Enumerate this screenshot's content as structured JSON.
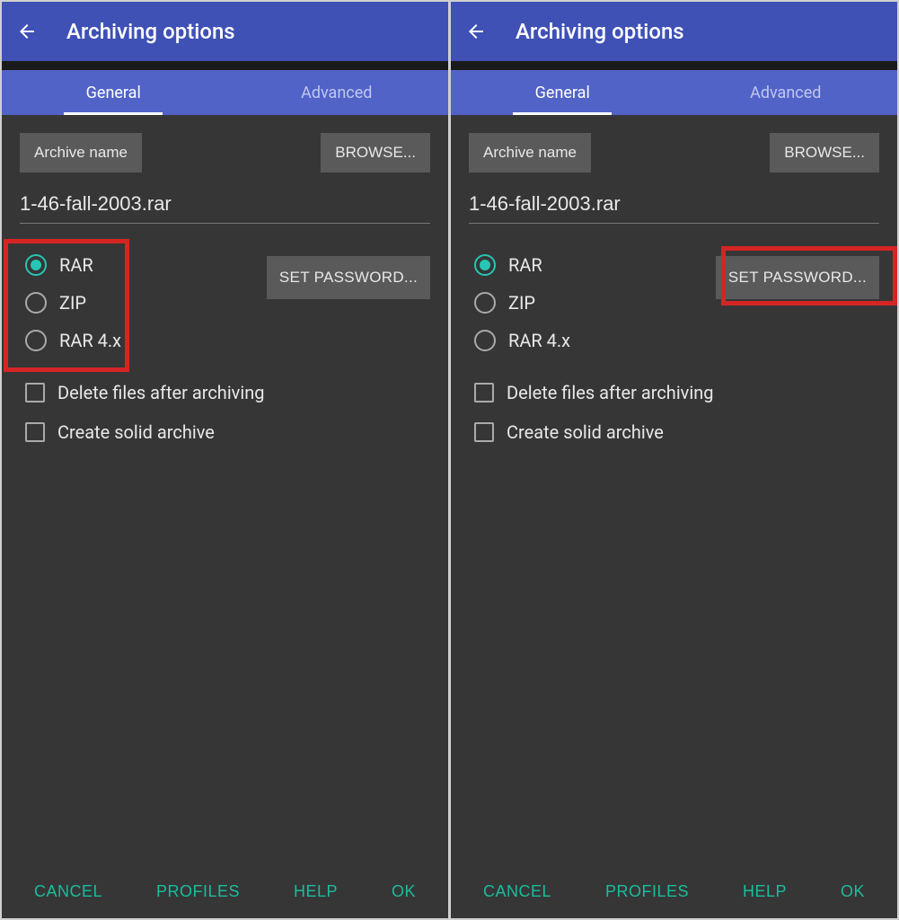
{
  "left": {
    "appbar": {
      "title": "Archiving options"
    },
    "tabs": {
      "general": "General",
      "advanced": "Advanced"
    },
    "archive_name_label": "Archive name",
    "browse_label": "BROWSE...",
    "filename": "1-46-fall-2003.rar",
    "formats": {
      "rar": "RAR",
      "zip": "ZIP",
      "rar4x": "RAR 4.x"
    },
    "set_password_label": "SET PASSWORD...",
    "checks": {
      "delete_after": "Delete files after archiving",
      "solid": "Create solid archive"
    },
    "footer": {
      "cancel": "CANCEL",
      "profiles": "PROFILES",
      "help": "HELP",
      "ok": "OK"
    },
    "highlight": "formats"
  },
  "right": {
    "appbar": {
      "title": "Archiving options"
    },
    "tabs": {
      "general": "General",
      "advanced": "Advanced"
    },
    "archive_name_label": "Archive name",
    "browse_label": "BROWSE...",
    "filename": "1-46-fall-2003.rar",
    "formats": {
      "rar": "RAR",
      "zip": "ZIP",
      "rar4x": "RAR 4.x"
    },
    "set_password_label": "SET PASSWORD...",
    "checks": {
      "delete_after": "Delete files after archiving",
      "solid": "Create solid archive"
    },
    "footer": {
      "cancel": "CANCEL",
      "profiles": "PROFILES",
      "help": "HELP",
      "ok": "OK"
    },
    "highlight": "set_password"
  },
  "colors": {
    "appbar": "#3f51b5",
    "tabs": "#5163c7",
    "accent_teal": "#1abc9c",
    "radio_teal": "#26c6b4",
    "highlight_red": "#d62424",
    "bg": "#363636",
    "button_bg": "#5a5a5a"
  }
}
